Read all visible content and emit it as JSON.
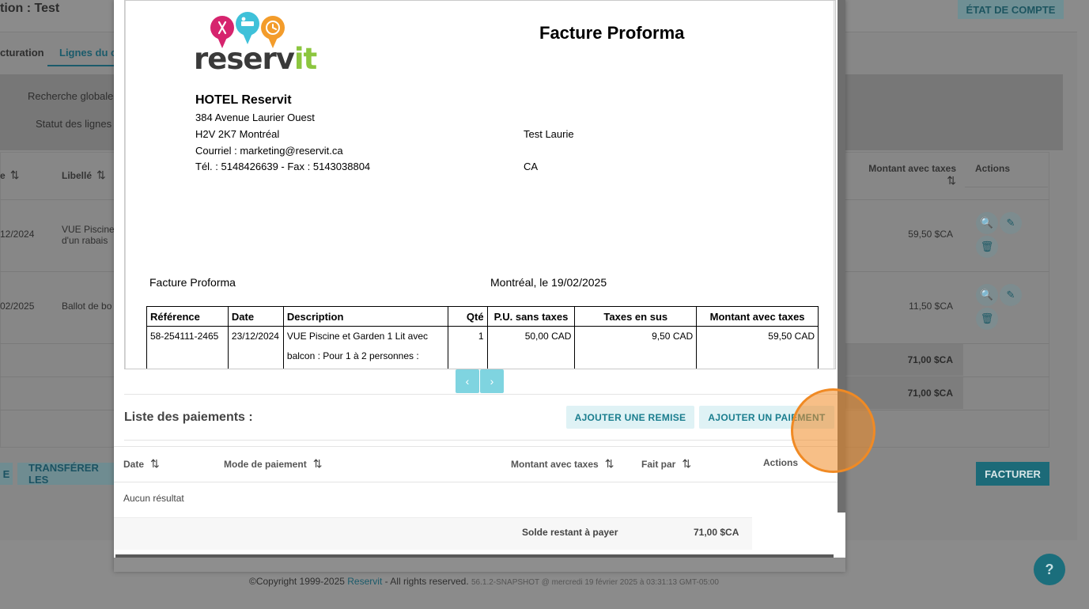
{
  "background": {
    "title": "tion : Test",
    "etat_button": "ÉTAT DE COMPTE",
    "tabs": [
      {
        "label": "cturation"
      },
      {
        "label": "Lignes du co"
      }
    ],
    "filters": {
      "search_label": "Recherche globale",
      "status_label": "Statut des lignes"
    },
    "table": {
      "headers": {
        "date": "e",
        "libelle": "Libellé",
        "montant": "Montant avec taxes",
        "actions": "Actions"
      },
      "rows": [
        {
          "date": "12/2024",
          "libelle_1": "VUE Piscine",
          "libelle_2": "d'un rabais",
          "montant": "59,50 $CA"
        },
        {
          "date": "02/2025",
          "libelle_1": "Ballot de bo",
          "libelle_2": "",
          "montant": "11,50 $CA"
        }
      ],
      "totals": [
        "71,00 $CA",
        "71,00 $CA"
      ]
    },
    "buttons": {
      "left_fragment": "E",
      "transferer": "TRANSFÉRER LES",
      "facturer": "FACTURER"
    },
    "footer": {
      "copyright": "©Copyright 1999-2025 ",
      "brand": "Reservit",
      "rights": " - All rights reserved. ",
      "version": "56.1.2-SNAPSHOT @ mercredi 19 février 2025 à 03:31:13 GMT-05:00"
    },
    "help": "?"
  },
  "invoice": {
    "logo_text_main": "reserv",
    "logo_text_accent": "it",
    "title": "Facture Proforma",
    "hotel": {
      "name": "HOTEL Reservit",
      "address": "384 Avenue Laurier Ouest",
      "city": "H2V 2K7 Montréal",
      "email": "Courriel : marketing@reservit.ca",
      "phone": "Tél. : 5148426639 - Fax : 5143038804"
    },
    "client": {
      "name": "Test Laurie",
      "country": "CA"
    },
    "doc_label": "Facture Proforma",
    "doc_date": "Montréal, le 19/02/2025",
    "columns": {
      "reference": "Référence",
      "date": "Date",
      "description": "Description",
      "qty": "Qté",
      "pu": "P.U. sans taxes",
      "taxes": "Taxes en sus",
      "total": "Montant avec taxes"
    },
    "rows": [
      {
        "reference": "58-254111-2465",
        "date": "23/12/2024",
        "description_1": "VUE Piscine et Garden 1 Lit avec",
        "description_2": "balcon : Pour 1 à 2 personnes :",
        "qty": "1",
        "pu": "50,00 CAD",
        "taxes": "9,50 CAD",
        "total": "59,50 CAD"
      }
    ]
  },
  "pager": {
    "prev": "‹",
    "next": "›"
  },
  "payments": {
    "title": "Liste des paiements :",
    "add_discount": "AJOUTER UNE REMISE",
    "add_payment": "AJOUTER UN PAIEMENT",
    "headers": {
      "date": "Date",
      "mode": "Mode de paiement",
      "montant": "Montant avec taxes",
      "fait_par": "Fait par",
      "actions": "Actions"
    },
    "empty": "Aucun résultat",
    "solde_label": "Solde restant à payer",
    "solde_value": "71,00 $CA"
  },
  "colors": {
    "accent": "#1a7d8e",
    "logo_pink": "#d6246e",
    "logo_blue": "#3fc1d9",
    "logo_orange": "#f39c2b",
    "logo_green": "#8cc63f",
    "click_indicator": "#f08a24"
  }
}
